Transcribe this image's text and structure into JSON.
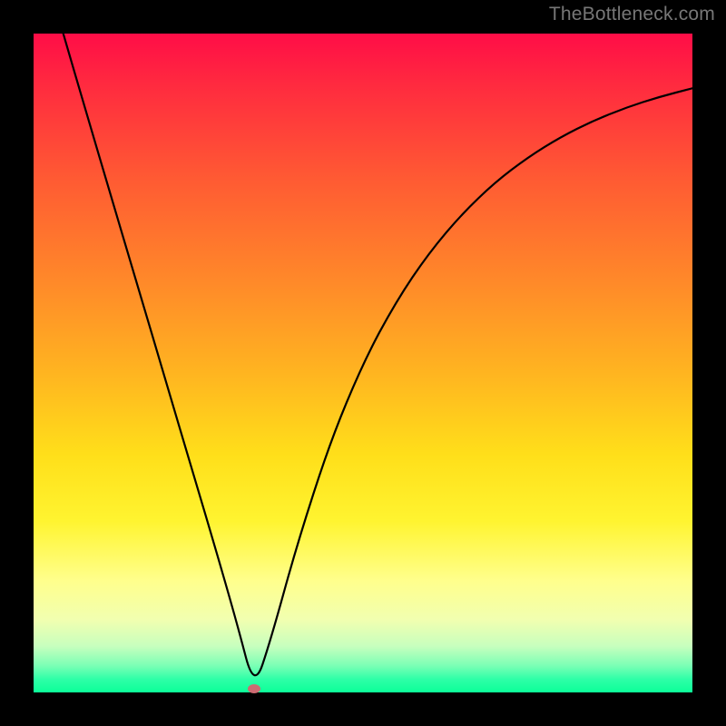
{
  "watermark": "TheBottleneck.com",
  "chart_data": {
    "type": "line",
    "title": "",
    "xlabel": "",
    "ylabel": "",
    "xlim": [
      0,
      1
    ],
    "ylim": [
      0,
      1
    ],
    "grid": false,
    "legend": false,
    "series": [
      {
        "name": "curve",
        "x": [
          0.045,
          0.08,
          0.12,
          0.16,
          0.2,
          0.24,
          0.28,
          0.31,
          0.335,
          0.36,
          0.4,
          0.45,
          0.5,
          0.55,
          0.6,
          0.65,
          0.7,
          0.75,
          0.8,
          0.85,
          0.9,
          0.95,
          1.0
        ],
        "y": [
          1.0,
          0.88,
          0.745,
          0.61,
          0.475,
          0.34,
          0.205,
          0.1,
          0.005,
          0.08,
          0.225,
          0.38,
          0.5,
          0.593,
          0.667,
          0.726,
          0.774,
          0.812,
          0.843,
          0.868,
          0.888,
          0.904,
          0.917
        ]
      }
    ],
    "marker": {
      "x": 0.335,
      "y": 0.005,
      "color": "#cd6b72"
    },
    "background_gradient": {
      "top": "#ff0d47",
      "middle": "#ffdf1a",
      "bottom": "#0cff99"
    }
  }
}
